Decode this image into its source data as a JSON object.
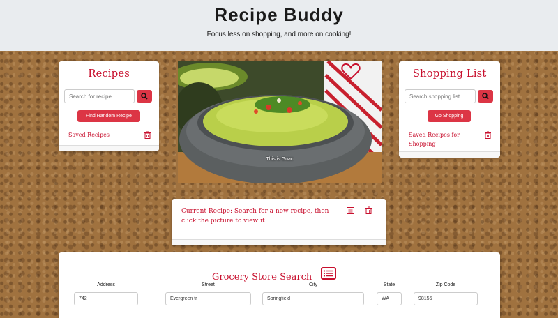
{
  "header": {
    "title": "Recipe Buddy",
    "tagline": "Focus less on shopping, and more on cooking!"
  },
  "recipes_card": {
    "title": "Recipes",
    "search_placeholder": "Search for recipe",
    "random_button": "Find Random Recipe",
    "saved_link": "Saved Recipes"
  },
  "hero": {
    "caption": "This is Guac",
    "favorite_icon": "heart-outline-icon"
  },
  "shopping_card": {
    "title": "Shopping List",
    "search_placeholder": "Search shopping list",
    "go_button": "Go Shopping",
    "saved_link": "Saved Recipes for Shopping"
  },
  "current_recipe": {
    "text": "Current Recipe: Search for a new recipe, then click the picture to view it!"
  },
  "grocery": {
    "title": "Grocery Store Search",
    "fields": [
      {
        "label": "Address",
        "value": "742"
      },
      {
        "label": "Street",
        "value": "Evergreen tr"
      },
      {
        "label": "City",
        "value": "Springfield"
      },
      {
        "label": "State",
        "value": "WA"
      },
      {
        "label": "Zip Code",
        "value": "98155"
      }
    ]
  },
  "colors": {
    "accent": "#dc3545",
    "title_red": "#c8102e",
    "header_bg": "#e9ecef"
  }
}
